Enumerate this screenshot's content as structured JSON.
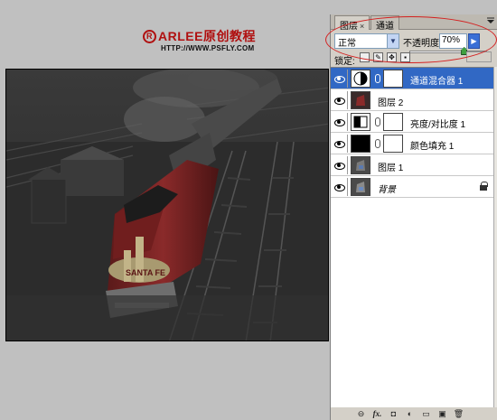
{
  "watermark": {
    "brand": "ARLEE原创教程",
    "url": "HTTP://WWW.PSFLY.COM",
    "accent": "#b01010"
  },
  "panel": {
    "tabs": [
      {
        "label": "图层",
        "close": "×"
      },
      {
        "label": "通道"
      }
    ],
    "menu_icon": "panel-menu-icon",
    "blend_mode": "正常",
    "opacity_label": "不透明度:",
    "opacity_value": "70%",
    "opacity_fraction": 0.7,
    "lock_label": "锁定:",
    "highlight_color": "#d42020",
    "selection_color": "#3168c4",
    "layers": [
      {
        "name": "通道混合器 1",
        "selected": true,
        "adjustment": "channel-mixer-icon",
        "has_mask": true
      },
      {
        "name": "图层 2",
        "selected": false,
        "adjustment": "",
        "has_mask": false
      },
      {
        "name": "亮度/对比度 1",
        "selected": false,
        "adjustment": "brightness-contrast-icon",
        "has_mask": true
      },
      {
        "name": "颜色填充 1",
        "selected": false,
        "adjustment": "color-fill",
        "has_mask": true
      },
      {
        "name": "图层 1",
        "selected": false,
        "adjustment": "",
        "has_mask": false
      },
      {
        "name": "背景",
        "selected": false,
        "adjustment": "",
        "has_mask": false,
        "locked": true
      }
    ],
    "bottom_icons": [
      "link-icon",
      "fx-icon",
      "mask-icon",
      "adjustment-icon",
      "group-folder-icon",
      "new-layer-icon",
      "trash-icon"
    ],
    "fx_label": "fx."
  }
}
